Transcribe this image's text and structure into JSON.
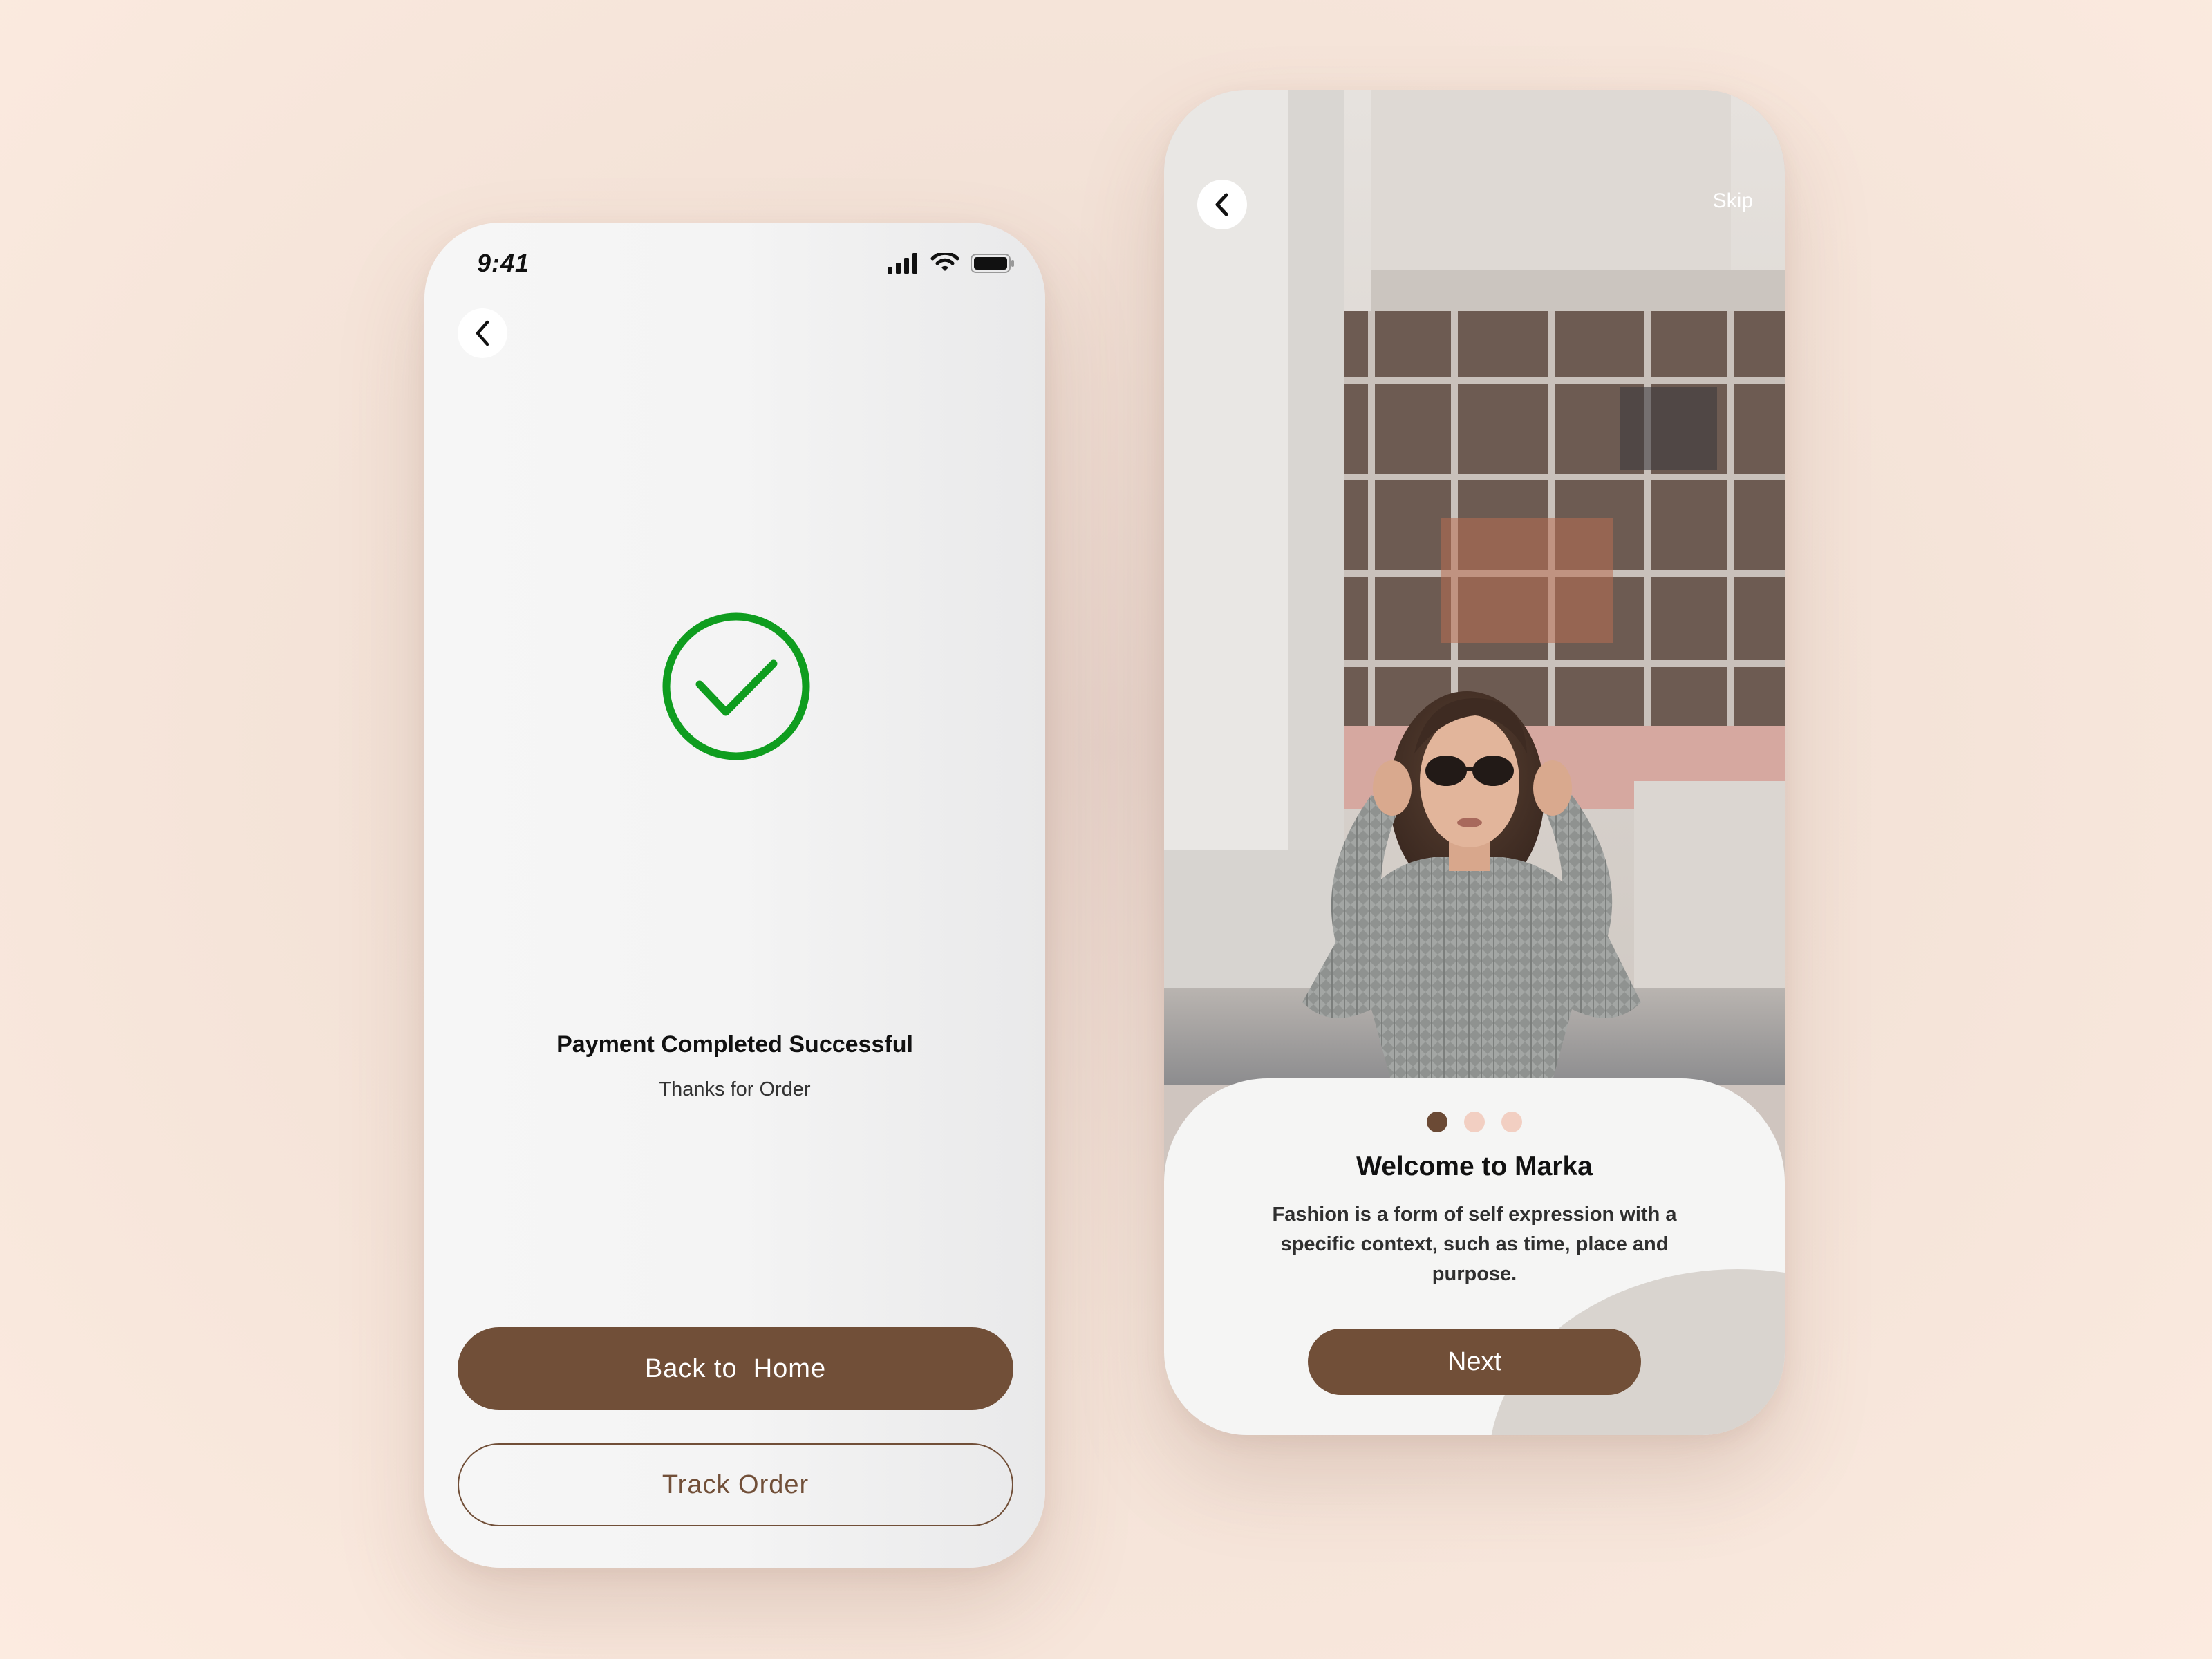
{
  "colors": {
    "accent": "#714f38",
    "success": "#0f9d1f",
    "dot_active": "#6b4a35",
    "dot_inactive": "#f2cfc2"
  },
  "payment_screen": {
    "status_bar": {
      "time": "9:41",
      "icons": [
        "cellular-signal-icon",
        "wifi-icon",
        "battery-icon"
      ]
    },
    "back_icon": "chevron-left-icon",
    "success_icon": "check-circle-icon",
    "title": "Payment Completed Successful",
    "subtitle": "Thanks for Order",
    "primary_button": "Back to  Home",
    "secondary_button": "Track Order"
  },
  "onboarding_screen": {
    "back_icon": "chevron-left-icon",
    "skip_label": "Skip",
    "image": "woman-in-sweater-and-sunglasses-photo",
    "pagination": {
      "total": 3,
      "active": 1
    },
    "title": "Welcome to Marka",
    "description": "Fashion is a form of self expression with a specific context, such as time, place and purpose.",
    "next_button": "Next"
  }
}
